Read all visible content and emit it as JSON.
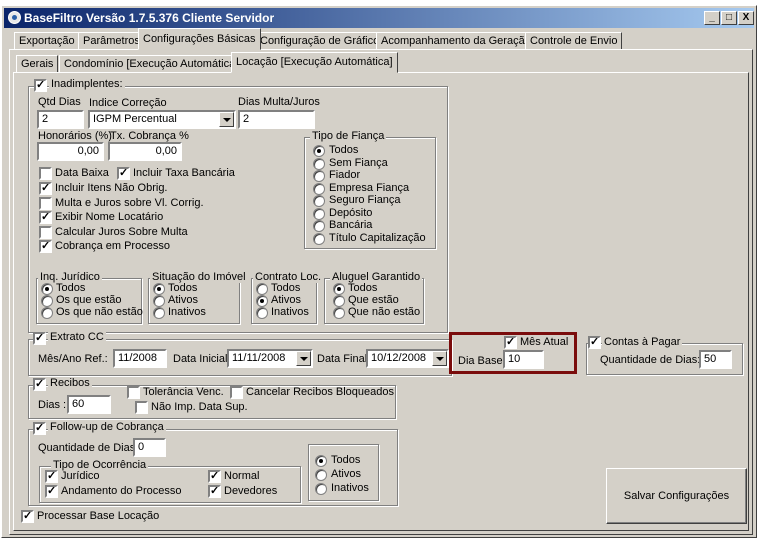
{
  "window": {
    "title": "BaseFiltro Versão 1.7.5.376 Cliente Servidor"
  },
  "title_buttons": {
    "min": "_",
    "max": "□",
    "close": "X"
  },
  "main_tabs": [
    "Exportação",
    "Parâmetros",
    "Configurações Básicas",
    "Configuração de Gráfico",
    "Acompanhamento da Geração",
    "Controle de Envio"
  ],
  "sub_tabs": [
    "Gerais",
    "Condomínio [Execução Automática]",
    "Locação [Execução Automática]"
  ],
  "inadimplentes": {
    "label": "Inadimplentes:",
    "qtd_dias_label": "Qtd Dias",
    "qtd_dias_value": "2",
    "indice_label": "Indice Correção",
    "indice_value": "IGPM Percentual",
    "dias_multa_label": "Dias Multa/Juros",
    "dias_multa_value": "2",
    "honorarios_label": "Honorários (%)",
    "honorarios_value": "0,00",
    "tx_cobranca_label": "Tx. Cobrança %",
    "tx_cobranca_value": "0,00",
    "checks": {
      "data_baixa": "Data Baixa",
      "incluir_taxa": "Incluir Taxa Bancária",
      "incluir_itens": "Incluir Itens Não Obrig.",
      "multa_juros": "Multa e Juros sobre Vl. Corrig.",
      "exibir_nome": "Exibir Nome Locatário",
      "calcular_juros": "Calcular Juros Sobre Multa",
      "cobranca_processo": "Cobrança em Processo"
    },
    "tipo_fianca": {
      "label": "Tipo de Fiança",
      "options": [
        "Todos",
        "Sem Fiança",
        "Fiador",
        "Empresa Fiança",
        "Seguro Fiança",
        "Depósito",
        "Bancária",
        "Título Capitalização"
      ]
    },
    "inq_juridico": {
      "label": "Inq. Jurídico",
      "options": [
        "Todos",
        "Os que estão",
        "Os que não estão"
      ]
    },
    "situacao_imovel": {
      "label": "Situação do Imóvel",
      "options": [
        "Todos",
        "Ativos",
        "Inativos"
      ]
    },
    "contrato_loc": {
      "label": "Contrato Loc.",
      "options": [
        "Todos",
        "Ativos",
        "Inativos"
      ]
    },
    "aluguel_garantido": {
      "label": "Aluguel Garantido",
      "options": [
        "Todos",
        "Que estão",
        "Que não estão"
      ]
    }
  },
  "extrato": {
    "label": "Extrato CC",
    "mes_ano_label": "Mês/Ano Ref.:",
    "mes_ano_value": "11/2008",
    "data_inicial_label": "Data Inicial",
    "data_inicial_value": "11/11/2008",
    "data_final_label": "Data Final",
    "data_final_value": "10/12/2008",
    "mes_atual_label": "Mês Atual",
    "dia_base_label": "Dia Base",
    "dia_base_value": "10"
  },
  "contas_pagar": {
    "label": "Contas à Pagar",
    "qtd_label": "Quantidade de Dias:",
    "qtd_value": "50"
  },
  "recibos": {
    "label": "Recibos",
    "dias_label": "Dias :",
    "dias_value": "60",
    "tolerancia": "Tolerância Venc.",
    "cancelar": "Cancelar Recibos Bloqueados",
    "nao_imp": "Não Imp. Data Sup."
  },
  "followup": {
    "label": "Follow-up de Cobrança",
    "qtd_label": "Quantidade de Dias:",
    "qtd_value": "0",
    "tipo_label": "Tipo de Ocorrência",
    "juridico": "Jurídico",
    "andamento": "Andamento do Processo",
    "normal": "Normal",
    "devedores": "Devedores",
    "status_options": [
      "Todos",
      "Ativos",
      "Inativos"
    ]
  },
  "processar_label": "Processar Base Locação",
  "save_button": "Salvar Configurações"
}
